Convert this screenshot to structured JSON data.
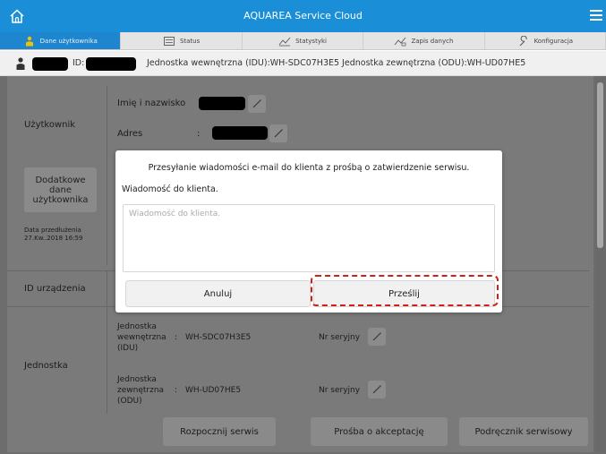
{
  "header": {
    "title": "AQUAREA Service Cloud"
  },
  "tabs": [
    {
      "label": "Dane użytkownika",
      "icon": "person-icon",
      "active": true
    },
    {
      "label": "Status",
      "icon": "panel-icon",
      "active": false
    },
    {
      "label": "Statystyki",
      "icon": "chart-icon",
      "active": false
    },
    {
      "label": "Zapis danych",
      "icon": "log-chart-icon",
      "active": false
    },
    {
      "label": "Konfiguracja",
      "icon": "wrench-icon",
      "active": false
    }
  ],
  "infobar": {
    "id_label": "ID:",
    "units_text": "Jednostka wewnętrzna (IDU):WH-SDC07H3E5   Jednostka zewnętrzna (ODU):WH-UD07HE5"
  },
  "user_section": {
    "label": "Użytkownik",
    "name_label": "Imię i nazwisko",
    "address_label": "Adres",
    "address_sep": ":",
    "extra_button": [
      "Dodatkowe",
      "dane",
      "użytkownika"
    ],
    "extension_label": "Data przedłużenia",
    "extension_date": "27.Kw..2018 16:59"
  },
  "device_section": {
    "label": "ID urządzenia"
  },
  "unit_section": {
    "label": "Jednostka",
    "idu_name": [
      "Jednostka",
      "wewnętrzna",
      "(IDU)"
    ],
    "idu_sep": ":",
    "idu_model": "WH-SDC07H3E5",
    "odu_name": [
      "Jednostka",
      "zewnętrzna",
      "(ODU)"
    ],
    "odu_sep": ":",
    "odu_model": "WH-UD07HE5",
    "serial_label": "Nr seryjny"
  },
  "bottom_buttons": {
    "start_service": "Rozpocznij serwis",
    "request_acceptance": "Prośba o akceptację",
    "service_manual": "Podręcznik serwisowy"
  },
  "modal": {
    "title": "Przesyłanie wiadomości e-mail do klienta z prośbą o zatwierdzenie serwisu.",
    "message_label": "Wiadomość do klienta.",
    "message_value": "",
    "message_placeholder": "Wiadomość do klienta.",
    "cancel_label": "Anuluj",
    "send_label": "Prześlij"
  },
  "colors": {
    "header_blue": "#1a8fd8",
    "active_tab": "#1d86cf",
    "overlay_gray": "#7a7a7a",
    "highlight_red": "#d0201a"
  }
}
